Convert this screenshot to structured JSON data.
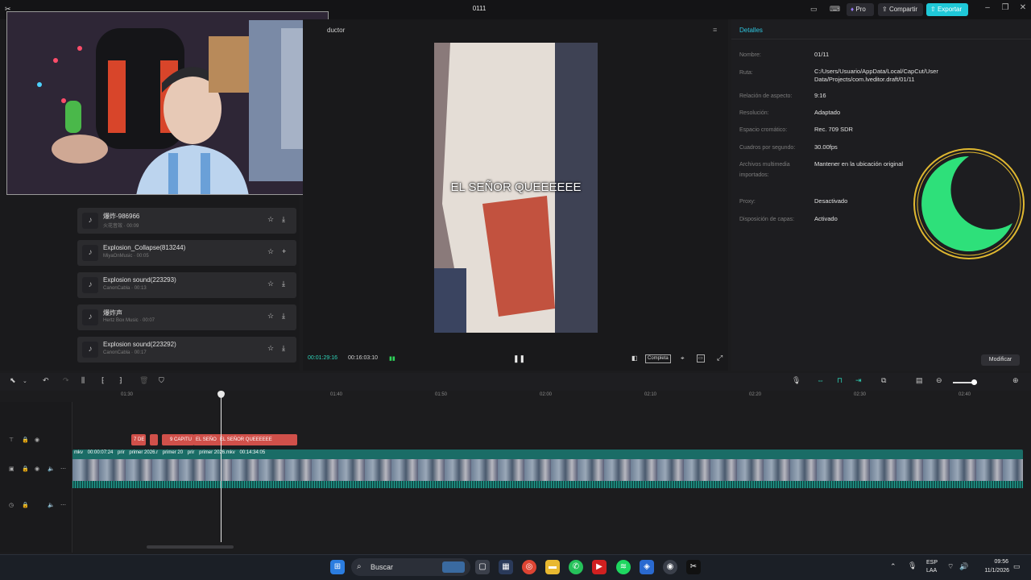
{
  "window": {
    "title": "0111",
    "pro_label": "Pro",
    "share_label": "Compartir",
    "export_label": "Exportar"
  },
  "media": {
    "items": [
      {
        "title": "爆炸-986966",
        "subtitle": "火花音效 · 00:09"
      },
      {
        "title": "Explosion_Collapse(813244)",
        "subtitle": "MiyaOnMusic · 00:05"
      },
      {
        "title": "Explosion sound(223293)",
        "subtitle": "CanonCabla · 00:13"
      },
      {
        "title": "爆炸声",
        "subtitle": "Hertz Box Music · 00:07"
      },
      {
        "title": "Explosion sound(223292)",
        "subtitle": "CanonCabla · 00:17"
      }
    ]
  },
  "player": {
    "label": "ductor",
    "caption": "EL SEÑOR QUEEEEEE",
    "current_time": "00:01:29:16",
    "total_time": "00:16:03:10",
    "view_mode": "Completa"
  },
  "details": {
    "title": "Detalles",
    "rows": [
      {
        "label": "Nombre:",
        "value": "01/11"
      },
      {
        "label": "Ruta:",
        "value": "C:/Users/Usuario/AppData/Local/CapCut/User Data/Projects/com.lveditor.draft/01/11"
      },
      {
        "label": "Relación de aspecto:",
        "value": "9:16"
      },
      {
        "label": "Resolución:",
        "value": "Adaptado"
      },
      {
        "label": "Espacio cromático:",
        "value": "Rec. 709 SDR"
      },
      {
        "label": "Cuadros por segundo:",
        "value": "30.00fps"
      },
      {
        "label": "Archivos multimedia importados:",
        "value": "Mantener en la ubicación original"
      },
      {
        "label": "Proxy:",
        "value": "Desactivado"
      },
      {
        "label": "Disposición de capas:",
        "value": "Activado"
      }
    ],
    "modify_label": "Modificar"
  },
  "timeline": {
    "ticks": [
      "01:30",
      "01:40",
      "01:50",
      "02:00",
      "02:10",
      "02:20",
      "02:30",
      "02:40"
    ],
    "subtitle_clips": [
      "7 DE",
      "",
      "9 CAPITU",
      "EL SEÑO",
      "EL SEÑOR QUEEEEEE"
    ],
    "video_labels": [
      "mkv",
      "00:00:07:24",
      "prir",
      "primer 2026.r",
      "primer 20",
      "prir",
      "primer 2026.mkv",
      "00:14:34:05"
    ]
  },
  "taskbar": {
    "search_placeholder": "Buscar",
    "lang_top": "ESP",
    "lang_bottom": "LAA",
    "time": "09:56",
    "date": "11/1/2026"
  },
  "colors": {
    "accent": "#1fc8d8",
    "subtitle_clip": "#d0504a",
    "video_track": "#1a6c66",
    "timecode": "#2fd3b8"
  }
}
